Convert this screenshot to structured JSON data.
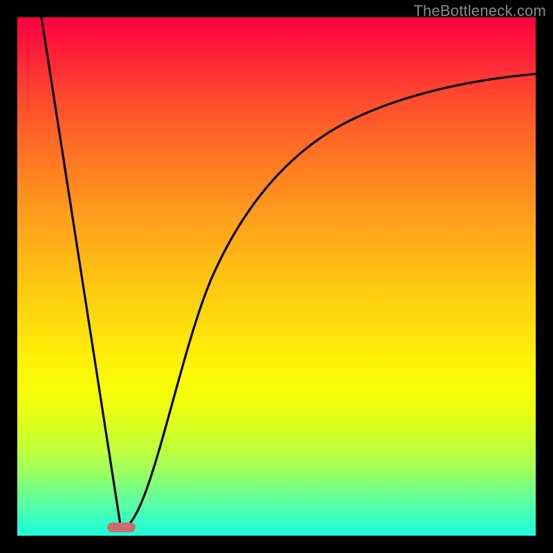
{
  "watermark": "TheBottleneck.com",
  "chart_data": {
    "type": "line",
    "title": "",
    "xlabel": "",
    "ylabel": "",
    "xlim": [
      0,
      100
    ],
    "ylim": [
      0,
      100
    ],
    "gradient_colors": {
      "top": "#ff0040",
      "mid_upper": "#ffae00",
      "mid_lower": "#ffff00",
      "bottom": "#1fffd9"
    },
    "series": [
      {
        "name": "v-curve",
        "note": "single black curve; left branch ~linear, right branch decelerating",
        "x": [
          0,
          5,
          10,
          15,
          18,
          20,
          22,
          25,
          28,
          32,
          36,
          40,
          45,
          50,
          56,
          62,
          70,
          78,
          86,
          94,
          100
        ],
        "y": [
          100,
          75,
          50,
          25,
          10,
          0,
          8,
          20,
          30,
          40,
          48,
          54,
          61,
          66,
          71,
          75,
          79,
          82,
          84,
          86,
          87
        ]
      }
    ],
    "marker": {
      "name": "min-marker",
      "color": "#cd6c6f",
      "x_center": 20,
      "width_pct": 5.5,
      "y": 1
    }
  }
}
